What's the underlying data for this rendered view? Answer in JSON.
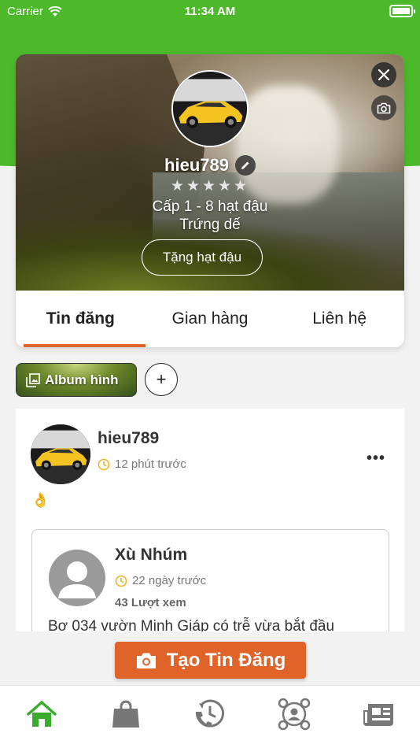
{
  "status_bar": {
    "carrier": "Carrier",
    "time": "11:34 AM"
  },
  "colors": {
    "brand_green": "#4cb92b",
    "accent_orange": "#e0642a"
  },
  "profile": {
    "username": "hieu789",
    "stars": "★★★★★",
    "level": "Cấp 1 - 8 hạt đậu",
    "rank": "Trứng dế",
    "gift_button": "Tặng hạt đậu"
  },
  "tabs": [
    {
      "label": "Tin đăng",
      "active": true
    },
    {
      "label": "Gian hàng",
      "active": false
    },
    {
      "label": "Liên hệ",
      "active": false
    }
  ],
  "album": {
    "label": "Album hình",
    "add_label": "+"
  },
  "post": {
    "author": "hieu789",
    "time": "12 phút trước",
    "content": "👌",
    "more": "•••",
    "shared": {
      "author": "Xù Nhúm",
      "time": "22 ngày trước",
      "views": "43 Lượt xem",
      "text": "Bơ 034 vườn Minh Giáp có trễ vừa bắt đầu"
    }
  },
  "create_post": {
    "label": "Tạo Tin Đăng"
  },
  "bottom_nav": [
    {
      "icon": "home-icon",
      "active": true
    },
    {
      "icon": "shopping-bag-icon",
      "active": false
    },
    {
      "icon": "phone-history-icon",
      "active": false
    },
    {
      "icon": "network-icon",
      "active": false
    },
    {
      "icon": "news-icon",
      "active": false
    }
  ]
}
